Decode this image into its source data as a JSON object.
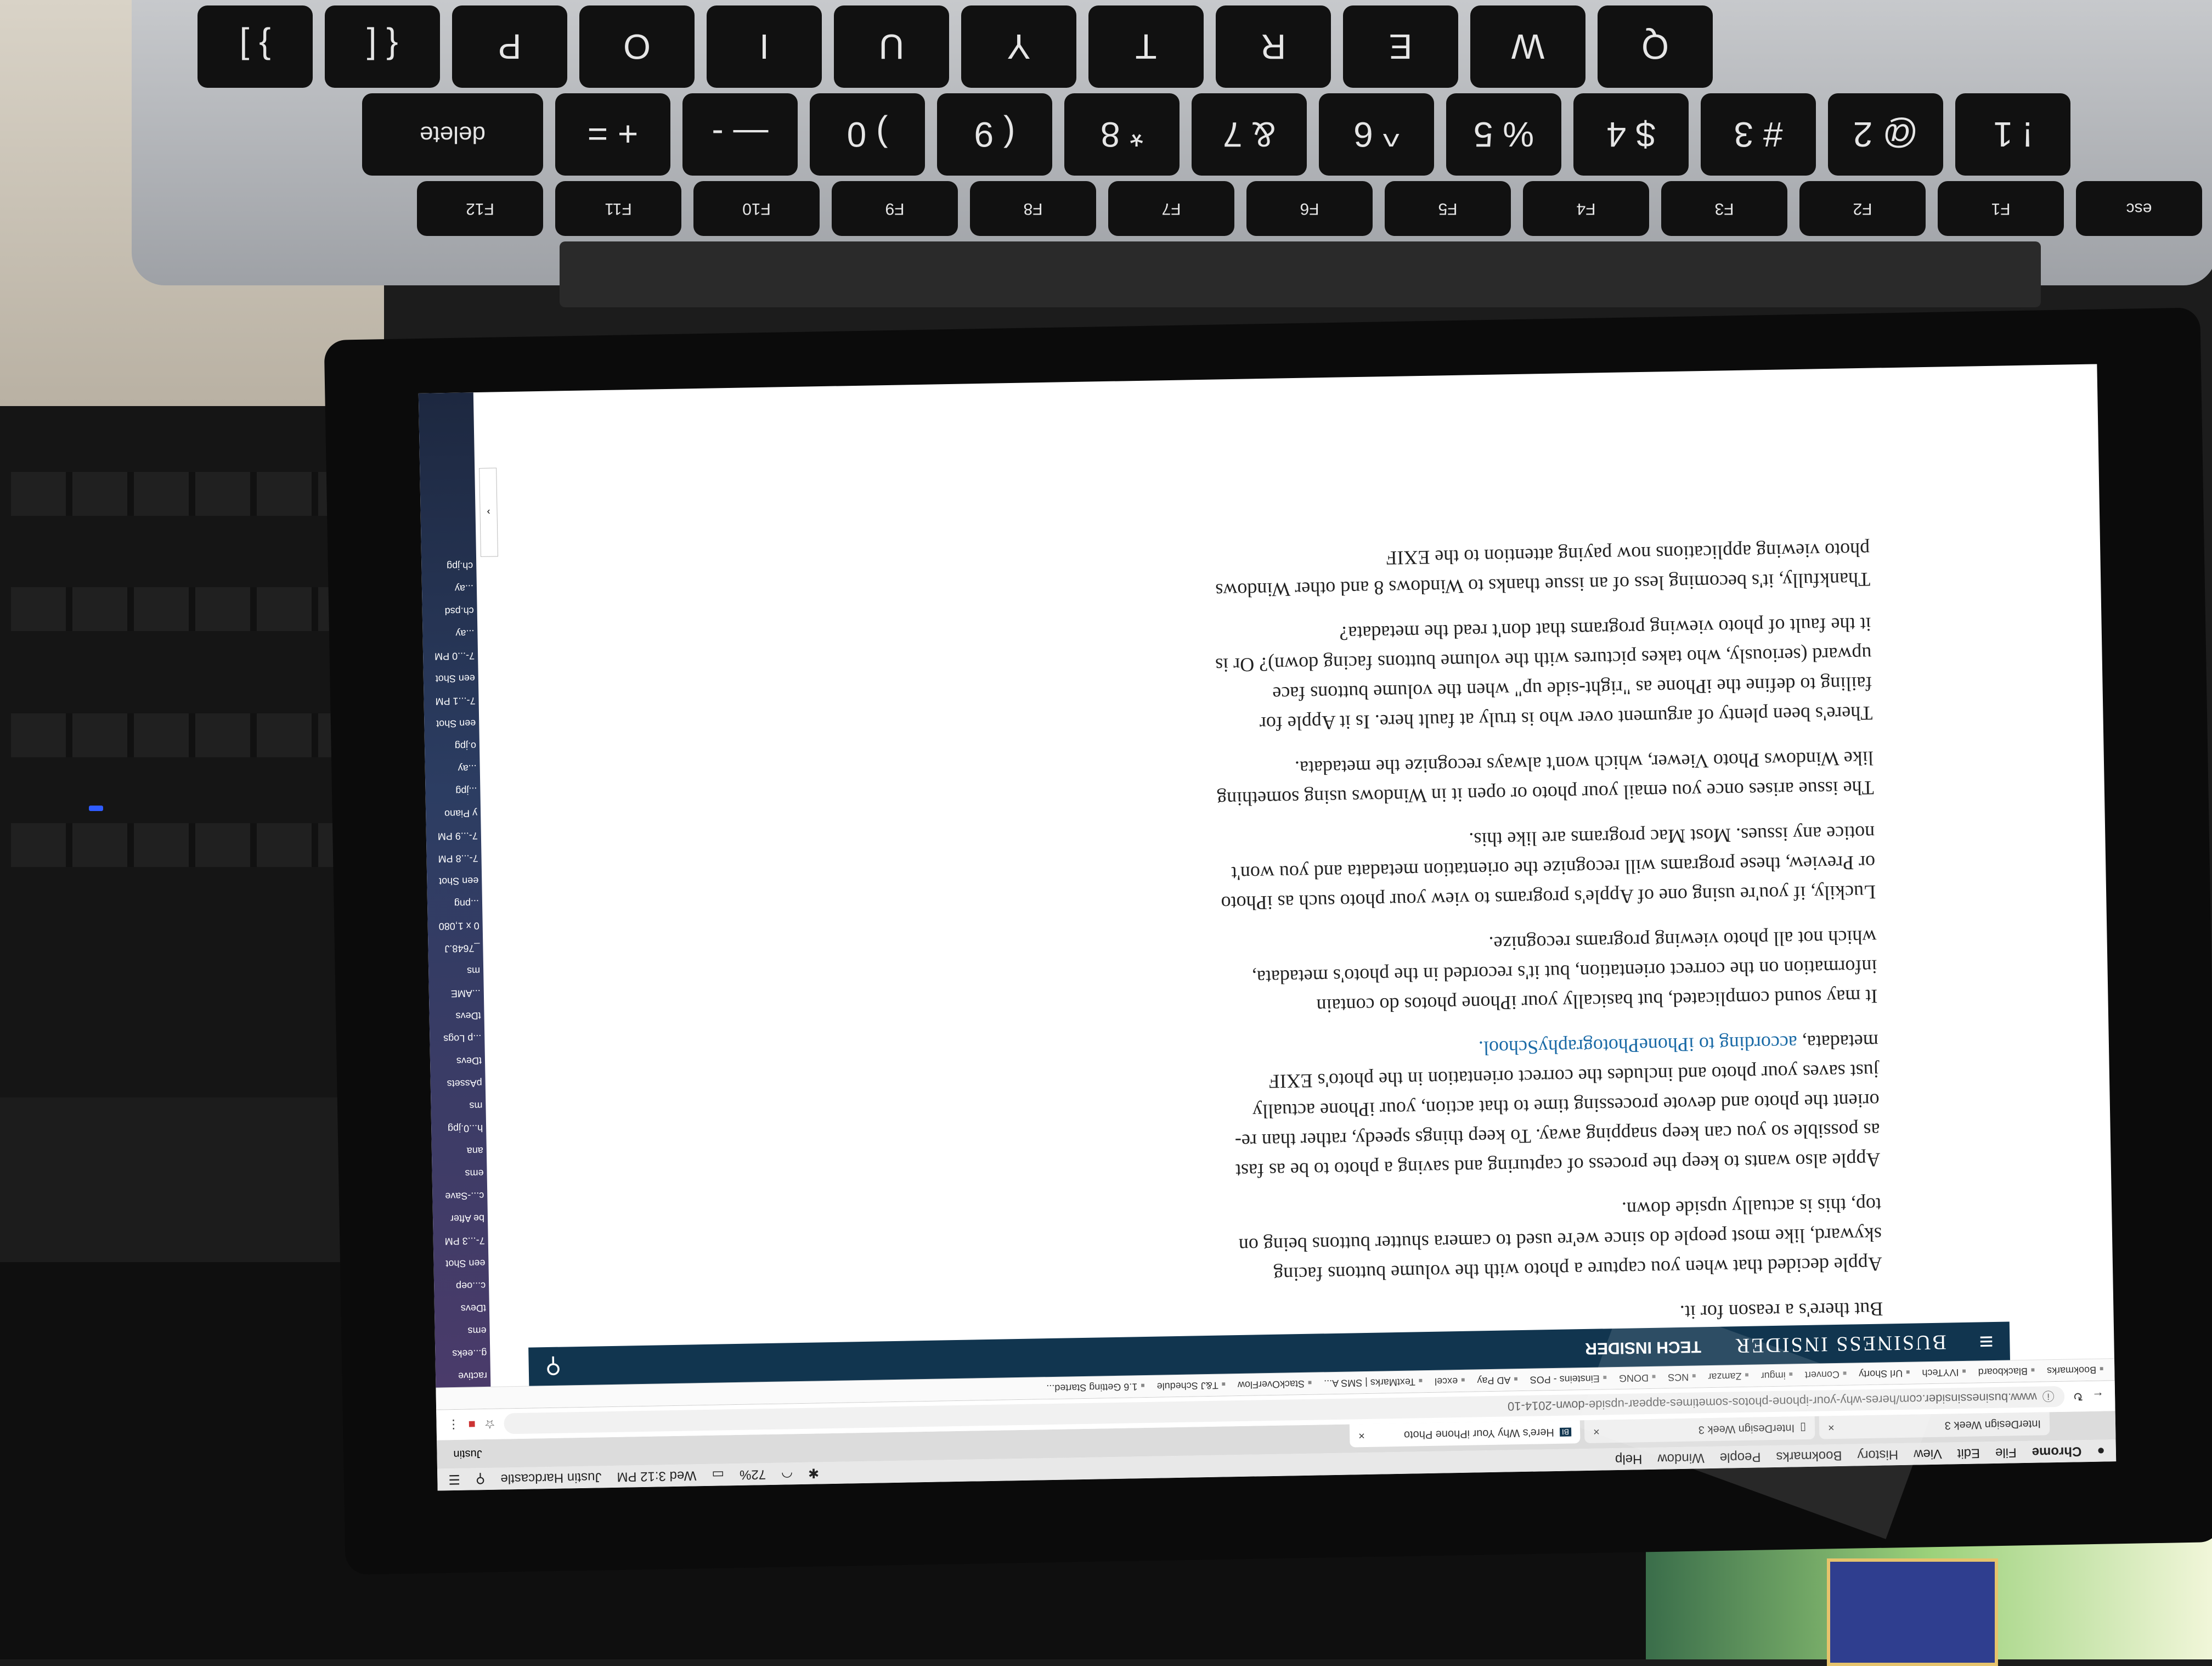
{
  "keyboard": {
    "number_row": [
      "delete",
      "+ =",
      "— -",
      ") 0",
      "( 9",
      "* 8",
      "& 7",
      "^ 6",
      "% 5",
      "$ 4",
      "# 3",
      "@ 2",
      "! 1"
    ],
    "letter_row": [
      "} ]",
      "{ [",
      "P",
      "O",
      "I",
      "U",
      "Y",
      "T",
      "R",
      "E",
      "W",
      "Q"
    ],
    "fn_row": [
      "F12",
      "F11",
      "F10",
      "F9",
      "F8",
      "F7",
      "F6",
      "F5",
      "F4",
      "F3",
      "F2",
      "F1",
      "esc"
    ]
  },
  "menubar": {
    "app": "Chrome",
    "items": [
      "File",
      "Edit",
      "View",
      "History",
      "Bookmarks",
      "People",
      "Window",
      "Help"
    ],
    "battery": "72%",
    "clock": "Wed 3:12 PM",
    "user": "Justin Hardcastle"
  },
  "tabs": [
    {
      "title": "InterDesign Week 3"
    },
    {
      "title": "InterDesign Week 3"
    },
    {
      "title": "Here's Why Your iPhone Photo"
    }
  ],
  "profile": "Justin",
  "url": "www.businessinsider.com/heres-why-your-iphone-photos-sometimes-appear-upside-down-2014-10",
  "bookmarks": [
    "Bookmarks",
    "Blackboard",
    "IVYTech",
    "Url Shorty",
    "Convert",
    "imgur",
    "Zamzar",
    "NCS",
    "DONG",
    "Einsteins - POS",
    "AD Pay",
    "excel",
    "TextMarks | SMS A...",
    "StackOverFlow",
    "T&J Schedule",
    "1.6 Getting Started..."
  ],
  "site": {
    "brand": "BUSINESS INSIDER",
    "section": "TECH INSIDER"
  },
  "article": {
    "p0": "But there's a reason for it.",
    "p1": "Apple decided that when you capture a photo with the volume buttons facing skyward, like most people do since we're used to camera shutter buttons being on top, this is actually upside down.",
    "p2": "Apple also wants to keep the process of capturing and saving a photo to be as fast as possible so you can keep snapping away. To keep things speedy, rather than re-orient the photo and devote processing time to that action, your iPhone actually just saves your photo and includes the correct orientation in the photo's EXIF metadata,",
    "p2_link": "according to iPhonePhotographySchool.",
    "p3": "It may sound complicated, but basically your iPhone photos do contain information on the correct orientation, but it's recorded in the photo's metadata, which not all photo viewing programs recognize.",
    "p4": "Luckily, if you're using one of Apple's programs to view your photo such as iPhoto or Preview, these programs will recognize the orientation metadata and you won't notice any issues. Most Mac programs are like this.",
    "p5": "The issue arises once you email your photo or open it in Windows using something like Windows Photo Viewer, which won't always recognize the metadata.",
    "p6": "There's been plenty of argument over who is truly at fault here. Is it Apple for failing to define the iPhone as \"right-side up\" when the volume buttons face upward (seriously, who takes pictures with the volume buttons facing down)? Or is it the fault of photo viewing programs that don't read the metadata?",
    "p7": "Thankfully, it's becoming less of an issue thanks to Windows 8 and other Windows photo viewing applications now paying attention to the EXIF"
  },
  "desktop_files": [
    "ractive",
    "g...eeks",
    "ems",
    "tDevs",
    "c...oep",
    "een Shot",
    "7-...3 PM",
    "be After",
    "c...-Save",
    "ems",
    "ana",
    "h...0.jpg",
    "ms",
    "pAssets",
    "tDevs",
    "...p Logs",
    "tDevs",
    "...AME",
    "ms",
    "_7648.J",
    "0 x 1,080",
    "...png",
    "een Shot",
    "7-...8 PM",
    "7-...9 PM",
    "y Piano",
    "...jpg",
    "...ay",
    "o.jpg",
    "een Shot",
    "7-...1 PM",
    "een Shot",
    "7-...0 PM",
    "...ay",
    "ch.psd",
    "...ay",
    "ch.jpg"
  ]
}
